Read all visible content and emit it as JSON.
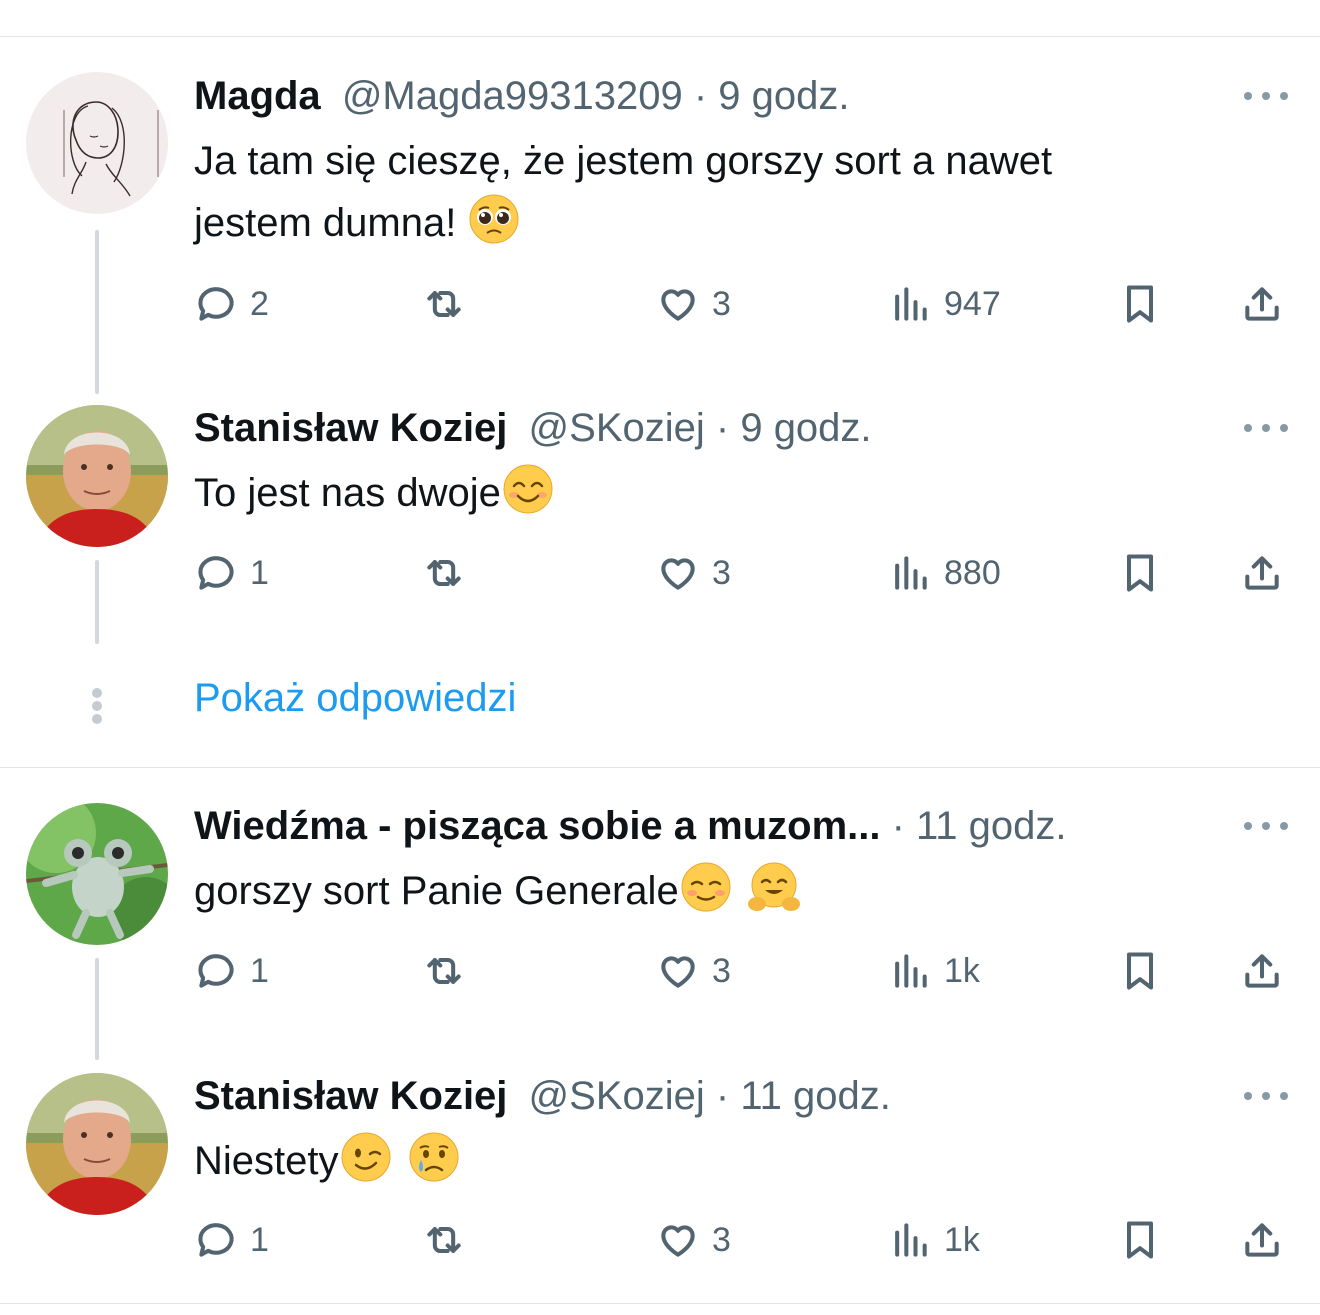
{
  "tweets": [
    {
      "name": "Magda",
      "handle": "@Magda99313209",
      "sep": " · ",
      "time": "9 godz.",
      "text_line1": "Ja tam się cieszę, że jestem gorszy sort a nawet",
      "text_line2": "jestem dumna! ",
      "emoji": [
        "pleading-face"
      ],
      "replies": "2",
      "retweets": "",
      "likes": "3",
      "views": "947"
    },
    {
      "name": "Stanisław Koziej",
      "handle": "@SKoziej",
      "sep": " · ",
      "time": "9 godz.",
      "text_line1": "To jest nas dwoje",
      "emoji": [
        "smiling-face-with-smiling-eyes"
      ],
      "replies": "1",
      "retweets": "",
      "likes": "3",
      "views": "880"
    },
    {
      "name": "Wiedźma - pisząca sobie a muzom...",
      "handle": "",
      "sep": " · ",
      "time": "11 godz.",
      "text_line1": "gorszy sort Panie Generale",
      "emoji": [
        "smiling-face",
        "hugging-face"
      ],
      "replies": "1",
      "retweets": "",
      "likes": "3",
      "views": "1k"
    },
    {
      "name": "Stanisław Koziej",
      "handle": "@SKoziej",
      "sep": " · ",
      "time": "11 godz.",
      "text_line1": "Niestety",
      "emoji": [
        "winking-face",
        "crying-face"
      ],
      "replies": "1",
      "retweets": "",
      "likes": "3",
      "views": "1k"
    }
  ],
  "show_replies": "Pokaż odpowiedzi",
  "colors": {
    "text": "#0f1419",
    "secondary": "#536471",
    "link": "#1d9bf0",
    "divider": "#e1e5e8"
  }
}
